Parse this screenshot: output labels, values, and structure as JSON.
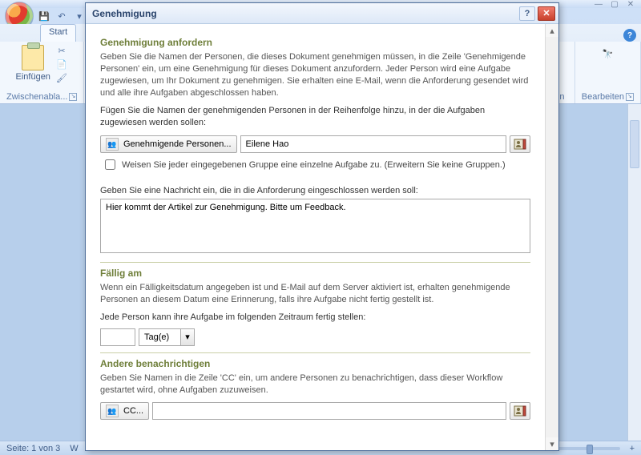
{
  "word": {
    "tab_start": "Start",
    "group_clipboard": "Zwischenabla...",
    "paste_label": "Einfügen",
    "group_right1": "agen",
    "group_right2": "Bearbeiten",
    "status_page": "Seite: 1 von 3",
    "status_w": "W"
  },
  "dialog": {
    "title": "Genehmigung",
    "sec1_title": "Genehmigung anfordern",
    "sec1_text": "Geben Sie die Namen der Personen, die dieses Dokument genehmigen müssen, in die Zeile 'Genehmigende Personen' ein, um eine Genehmigung für dieses Dokument anzufordern.   Jeder Person wird eine Aufgabe zugewiesen, um Ihr Dokument zu genehmigen. Sie erhalten eine E-Mail, wenn die Anforderung gesendet wird und alle ihre Aufgaben abgeschlossen haben.",
    "order_text": "Fügen Sie die Namen der genehmigenden Personen in der Reihenfolge hinzu, in der die Aufgaben zugewiesen werden sollen:",
    "approvers_btn": "Genehmigende Personen...",
    "approvers_value": "Eilene Hao",
    "chk_label": "Weisen Sie jeder eingegebenen Gruppe eine einzelne Aufgabe zu. (Erweitern Sie keine Gruppen.)",
    "msg_label": "Geben Sie eine Nachricht ein, die in die Anforderung eingeschlossen werden soll:",
    "msg_value": "Hier kommt der Artikel zur Genehmigung. Bitte um Feedback.",
    "sec2_title": "Fällig am",
    "sec2_text": "Wenn ein Fälligkeitsdatum angegeben ist und E-Mail auf dem Server aktiviert ist, erhalten genehmigende Personen an diesem Datum eine Erinnerung, falls ihre Aufgabe nicht fertig gestellt ist.",
    "each_label": "Jede Person kann ihre Aufgabe im folgenden Zeitraum fertig stellen:",
    "unit_value": "Tag(e)",
    "sec3_title": "Andere benachrichtigen",
    "sec3_text": "Geben Sie Namen in die Zeile 'CC' ein, um andere Personen zu benachrichtigen, dass dieser Workflow gestartet wird, ohne Aufgaben zuzuweisen.",
    "cc_btn": "CC..."
  }
}
